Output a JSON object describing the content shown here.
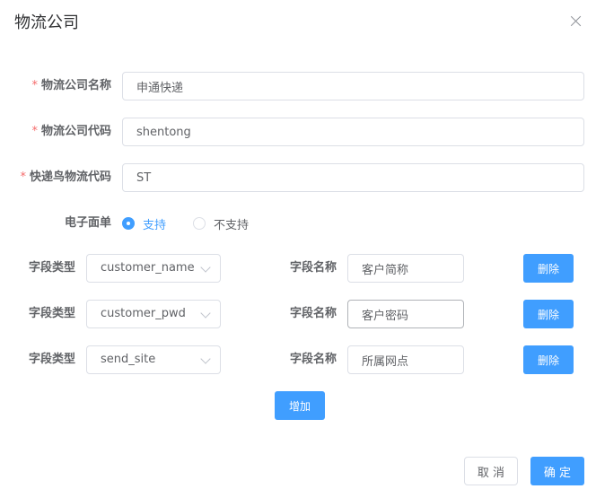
{
  "dialog": {
    "title": "物流公司"
  },
  "form": {
    "company_name": {
      "required_mark": "*",
      "label": "物流公司名称",
      "value": "申通快递"
    },
    "company_code": {
      "required_mark": "*",
      "label": "物流公司代码",
      "value": "shentong"
    },
    "kdn_code": {
      "required_mark": "*",
      "label": "快递鸟物流代码",
      "value": "ST"
    },
    "e_waybill": {
      "label": "电子面单",
      "options": [
        {
          "label": "支持",
          "checked": true
        },
        {
          "label": "不支持",
          "checked": false
        }
      ]
    },
    "fields": [
      {
        "type_label": "字段类型",
        "type_value": "customer_name",
        "name_label": "字段名称",
        "name_value": "客户简称",
        "delete_label": "删除"
      },
      {
        "type_label": "字段类型",
        "type_value": "customer_pwd",
        "name_label": "字段名称",
        "name_value": "客户密码",
        "delete_label": "删除"
      },
      {
        "type_label": "字段类型",
        "type_value": "send_site",
        "name_label": "字段名称",
        "name_value": "所属网点",
        "delete_label": "删除"
      }
    ],
    "add_label": "增加"
  },
  "footer": {
    "cancel_label": "取 消",
    "confirm_label": "确 定"
  },
  "colors": {
    "primary": "#409eff",
    "required": "#f56c6c",
    "border": "#dcdfe6",
    "text": "#606266"
  }
}
